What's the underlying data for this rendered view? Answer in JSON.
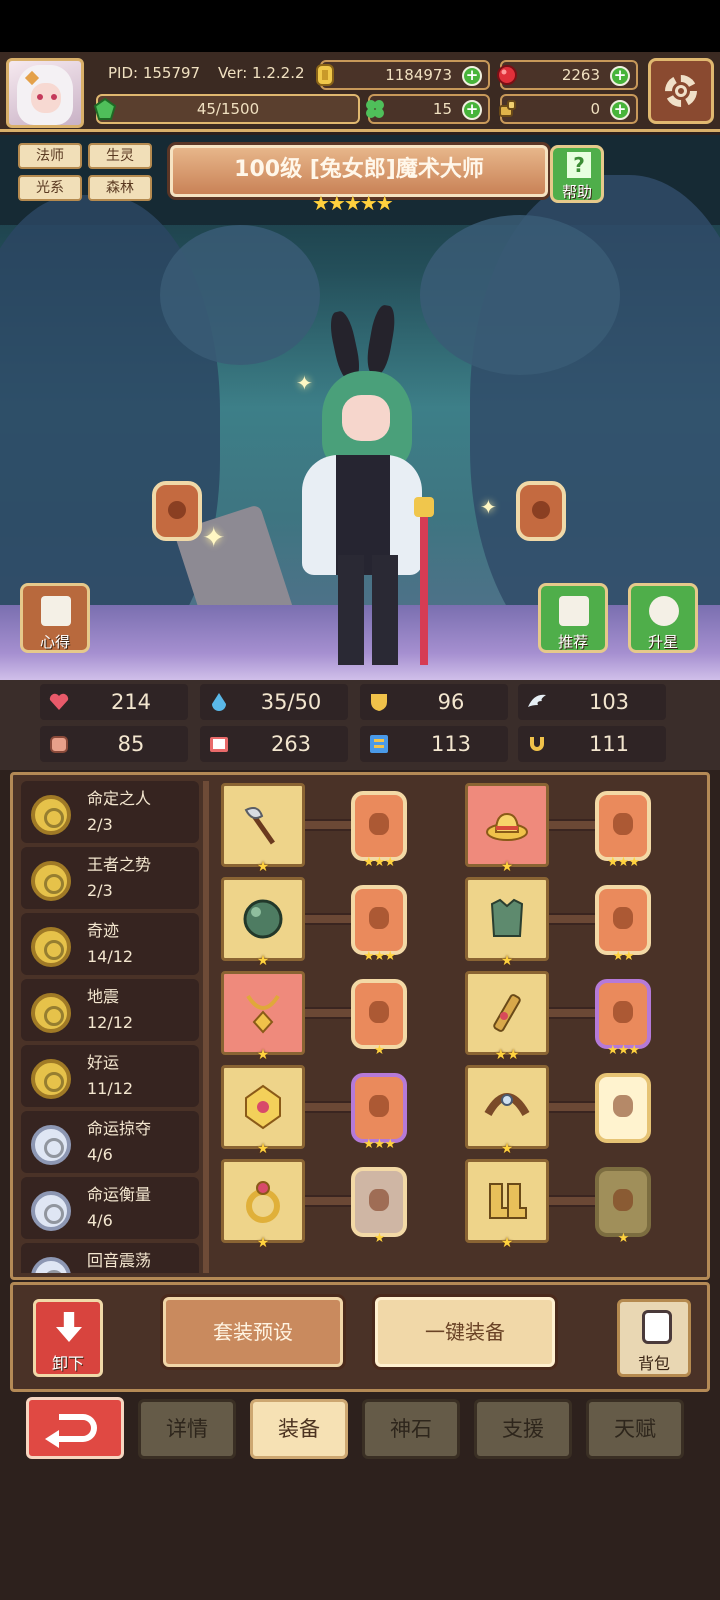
{
  "player": {
    "pid": "PID: 155797",
    "version": "Ver: 1.2.2.2",
    "coins": "1184973",
    "gems": "2263",
    "energy": "45/1500",
    "clovers": "15",
    "tokens": "0"
  },
  "hero": {
    "tags": [
      "法师",
      "生灵",
      "光系",
      "森林"
    ],
    "title": "100级 [兔女郎]魔术大师",
    "stars": "★★★★★",
    "help_label": "帮助",
    "xinde_label": "心得",
    "tuijian_label": "推荐",
    "shengxing_label": "升星"
  },
  "stats": [
    {
      "icon": "heart-icon",
      "value": "214",
      "color": "#e85a6a"
    },
    {
      "icon": "mana-drop-icon",
      "value": "35/50",
      "color": "#5ab8e8"
    },
    {
      "icon": "shield-icon",
      "value": "96",
      "color": "#f0c24a"
    },
    {
      "icon": "wing-icon",
      "value": "103",
      "color": "#e6eef4"
    },
    {
      "icon": "fist-icon",
      "value": "85",
      "color": "#e8a08a"
    },
    {
      "icon": "book-icon",
      "value": "263",
      "color": "#e86a6a"
    },
    {
      "icon": "scroll-icon",
      "value": "113",
      "color": "#4a9ae8"
    },
    {
      "icon": "horseshoe-icon",
      "value": "111",
      "color": "#f0c24a"
    }
  ],
  "sets": [
    {
      "name": "命定之人",
      "count": "2/3",
      "tier": "gold"
    },
    {
      "name": "王者之势",
      "count": "2/3",
      "tier": "gold"
    },
    {
      "name": "奇迹",
      "count": "14/12",
      "tier": "gold"
    },
    {
      "name": "地震",
      "count": "12/12",
      "tier": "gold"
    },
    {
      "name": "好运",
      "count": "11/12",
      "tier": "gold"
    },
    {
      "name": "命运掠夺",
      "count": "4/6",
      "tier": "silver"
    },
    {
      "name": "命运衡量",
      "count": "4/6",
      "tier": "silver"
    },
    {
      "name": "回音震荡",
      "count": "",
      "tier": "silver"
    }
  ],
  "equipment": [
    {
      "item": "axe-icon",
      "item_stars": "★",
      "rune_stars": "★★★",
      "slot": "gold",
      "rune": "orange"
    },
    {
      "item": "hat-icon",
      "item_stars": "★",
      "rune_stars": "★★★",
      "slot": "red",
      "rune": "orange"
    },
    {
      "item": "orb-icon",
      "item_stars": "★",
      "rune_stars": "★★★",
      "slot": "gold",
      "rune": "orange"
    },
    {
      "item": "armor-icon",
      "item_stars": "★",
      "rune_stars": "★★",
      "slot": "gold",
      "rune": "orange"
    },
    {
      "item": "necklace-icon",
      "item_stars": "★",
      "rune_stars": "★",
      "slot": "red",
      "rune": "orange"
    },
    {
      "item": "bracer-icon",
      "item_stars": "★★",
      "rune_stars": "★★★",
      "slot": "gold",
      "rune": "purple"
    },
    {
      "item": "emblem-icon",
      "item_stars": "★",
      "rune_stars": "★★★",
      "slot": "gold",
      "rune": "purple"
    },
    {
      "item": "belt-icon",
      "item_stars": "★",
      "rune_stars": "",
      "slot": "gold",
      "rune": "white"
    },
    {
      "item": "ring-icon",
      "item_stars": "★",
      "rune_stars": "★",
      "slot": "gold",
      "rune": "gray"
    },
    {
      "item": "boots-icon",
      "item_stars": "★",
      "rune_stars": "★",
      "slot": "gold",
      "rune": "olive"
    }
  ],
  "actions": {
    "unequip": "卸下",
    "preset": "套装预设",
    "one_click": "一键装备",
    "bag": "背包"
  },
  "tabs": [
    "详情",
    "装备",
    "神石",
    "支援",
    "天赋"
  ],
  "active_tab": "装备"
}
